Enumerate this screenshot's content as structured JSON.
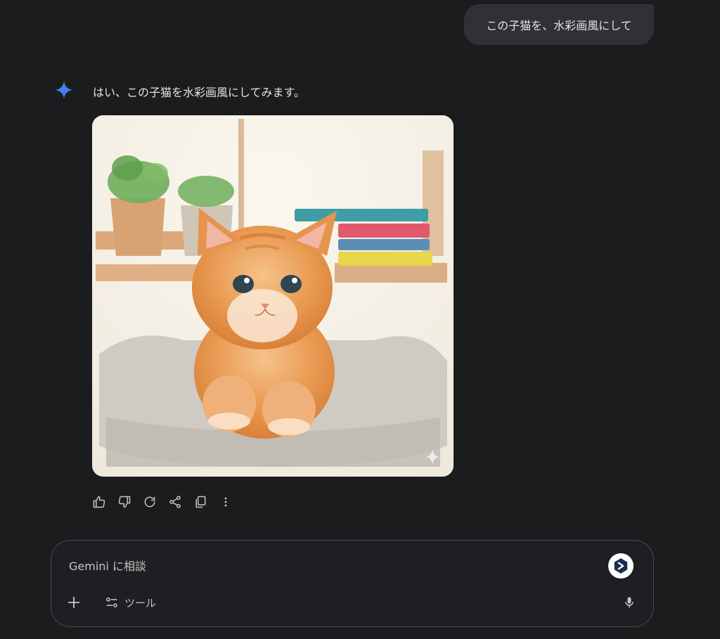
{
  "conversation": {
    "user_message": "この子猫を、水彩画風にして",
    "assistant_message": "はい、この子猫を水彩画風にしてみます。"
  },
  "response_actions": [
    {
      "icon": "thumb-up-icon"
    },
    {
      "icon": "thumb-down-icon"
    },
    {
      "icon": "regenerate-icon"
    },
    {
      "icon": "share-icon"
    },
    {
      "icon": "copy-icon"
    },
    {
      "icon": "more-vert-icon"
    }
  ],
  "composer": {
    "placeholder": "Gemini に相談",
    "tools_label": "ツール"
  },
  "colors": {
    "background": "#1b1c1e",
    "bubble": "#303134",
    "accent_blue": "#4285f4"
  }
}
